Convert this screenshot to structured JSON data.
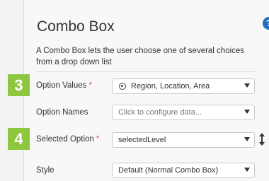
{
  "panel": {
    "title": "Combo Box",
    "help_icon_glyph": "?",
    "description": "A Combo Box lets the user choose one of several choices from a drop down list"
  },
  "badges": {
    "step3": "3",
    "step4": "4"
  },
  "fields": {
    "option_values": {
      "label": "Option Values",
      "required_mark": "*",
      "value": "Region, Location, Area",
      "icon": "target-icon"
    },
    "option_names": {
      "label": "Option Names",
      "placeholder": "Click to configure data..."
    },
    "selected_option": {
      "label": "Selected Option",
      "required_mark": "*",
      "value": "selectedLevel",
      "side_icon": "sort-icon"
    },
    "style": {
      "label": "Style",
      "value": "Default (Normal Combo Box)"
    }
  },
  "colors": {
    "badge": "#8dc63f",
    "help": "#1f6fbf",
    "required": "#d9534f"
  }
}
